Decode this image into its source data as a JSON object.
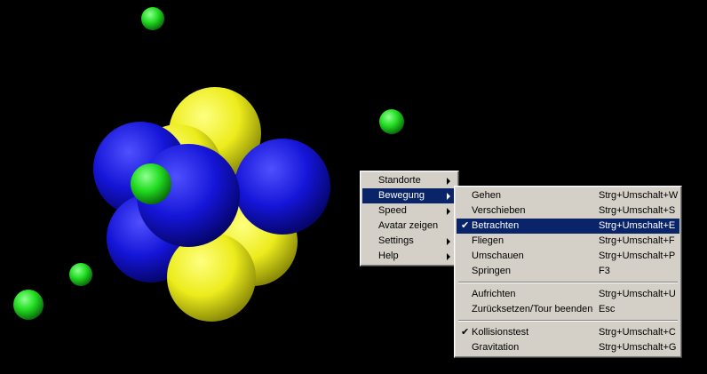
{
  "main_menu": {
    "items": [
      {
        "label": "Standorte",
        "submenu": true,
        "selected": false
      },
      {
        "label": "Bewegung",
        "submenu": true,
        "selected": true
      },
      {
        "label": "Speed",
        "submenu": true,
        "selected": false
      },
      {
        "label": "Avatar zeigen",
        "submenu": false,
        "selected": false
      },
      {
        "label": "Settings",
        "submenu": true,
        "selected": false
      },
      {
        "label": "Help",
        "submenu": true,
        "selected": false
      }
    ]
  },
  "bewegung_menu": {
    "groups": [
      [
        {
          "label": "Gehen",
          "shortcut": "Strg+Umschalt+W",
          "checked": false,
          "selected": false
        },
        {
          "label": "Verschieben",
          "shortcut": "Strg+Umschalt+S",
          "checked": false,
          "selected": false
        },
        {
          "label": "Betrachten",
          "shortcut": "Strg+Umschalt+E",
          "checked": true,
          "selected": true
        },
        {
          "label": "Fliegen",
          "shortcut": "Strg+Umschalt+F",
          "checked": false,
          "selected": false
        },
        {
          "label": "Umschauen",
          "shortcut": "Strg+Umschalt+P",
          "checked": false,
          "selected": false
        },
        {
          "label": "Springen",
          "shortcut": "F3",
          "checked": false,
          "selected": false
        }
      ],
      [
        {
          "label": "Aufrichten",
          "shortcut": "Strg+Umschalt+U",
          "checked": false,
          "selected": false
        },
        {
          "label": "Zurücksetzen/Tour beenden",
          "shortcut": "Esc",
          "checked": false,
          "selected": false
        }
      ],
      [
        {
          "label": "Kollisionstest",
          "shortcut": "Strg+Umschalt+C",
          "checked": true,
          "selected": false
        },
        {
          "label": "Gravitation",
          "shortcut": "Strg+Umschalt+G",
          "checked": false,
          "selected": false
        }
      ]
    ]
  },
  "colors": {
    "background": "#000000",
    "menu_bg": "#d4d0c8",
    "highlight": "#0a246a",
    "sphere_blue": "#1515d8",
    "sphere_yellow": "#ecec1c",
    "sphere_green": "#22dd22"
  }
}
